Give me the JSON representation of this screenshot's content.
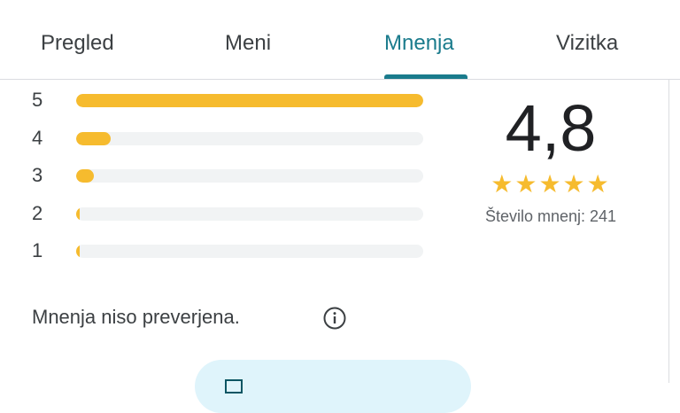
{
  "tabs": [
    {
      "label": "Pregled",
      "active": false
    },
    {
      "label": "Meni",
      "active": false
    },
    {
      "label": "Mnenja",
      "active": true
    },
    {
      "label": "Vizitka",
      "active": false
    }
  ],
  "colors": {
    "accent": "#1a7b8c",
    "star": "#f6bb2e",
    "track": "#f1f3f4",
    "button_bg": "#dff4fb"
  },
  "ratings": [
    {
      "stars": "5",
      "share": 1.0
    },
    {
      "stars": "4",
      "share": 0.1
    },
    {
      "stars": "3",
      "share": 0.05
    },
    {
      "stars": "2",
      "share": 0.01
    },
    {
      "stars": "1",
      "share": 0.01
    }
  ],
  "summary": {
    "average": "4,8",
    "stars": "★★★★★",
    "count_text": "Število mnenj: 241"
  },
  "note": {
    "text": "Mnenja niso preverjena.",
    "icon": "info-icon"
  },
  "write_review": {
    "icon": "edit-icon"
  }
}
